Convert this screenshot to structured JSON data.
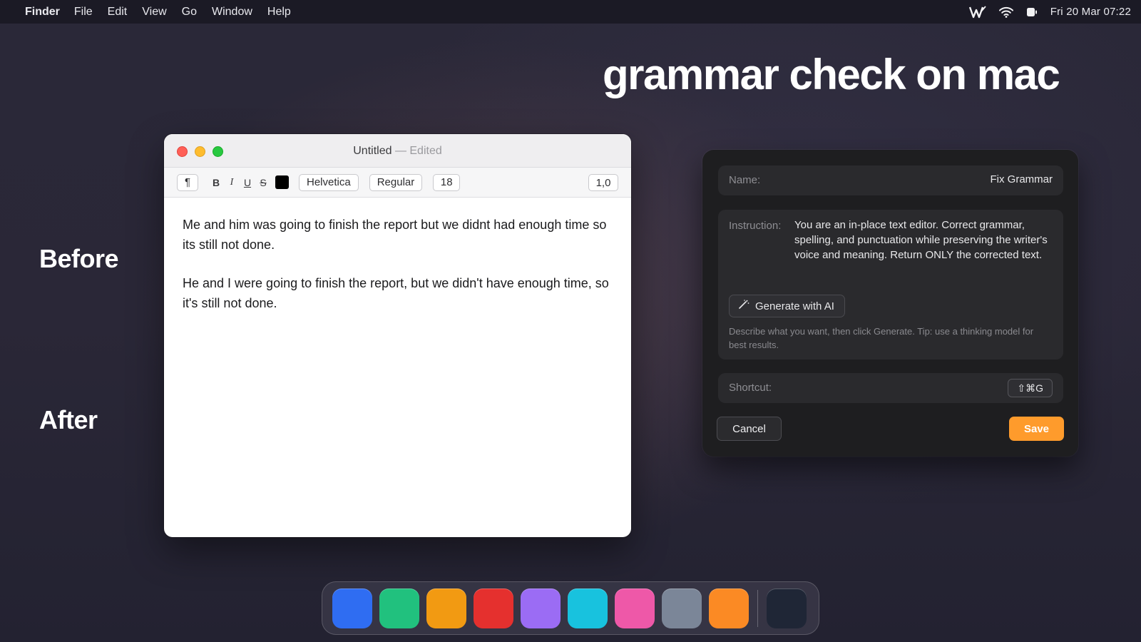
{
  "menubar": {
    "app_name": "Finder",
    "items": [
      "File",
      "Edit",
      "View",
      "Go",
      "Window",
      "Help"
    ],
    "status_icons": [
      "writing-tool-icon",
      "wifi-icon",
      "battery-icon"
    ],
    "clock": "Fri 20 Mar  07:22"
  },
  "headline": "grammar check on mac",
  "labels": {
    "before": "Before",
    "after": "After"
  },
  "editor": {
    "title": "Untitled",
    "title_suffix": "— Edited",
    "toolbar": {
      "paragraph_symbol": "¶",
      "bold": "B",
      "italic": "I",
      "underline": "U",
      "strikethrough": "S",
      "text_color": "#000000",
      "font_family": "Helvetica",
      "font_style": "Regular",
      "font_size": "18",
      "line_spacing": "1,0"
    },
    "paragraphs": [
      "Me and him was going to finish the report but we didnt had enough time so its still not done.",
      "He and I were going to finish the report, but we didn't have enough time, so it's still not done."
    ]
  },
  "panel": {
    "name_label": "Name:",
    "name_value": "Fix Grammar",
    "instruction_label": "Instruction:",
    "instruction_text": "You are an in-place text editor. Correct grammar, spelling, and punctuation while preserving the writer's voice and meaning. Return ONLY the corrected text.",
    "generate_label": "Generate with AI",
    "hint": "Describe what you want, then click Generate. Tip: use a thinking model for best results.",
    "shortcut_label": "Shortcut:",
    "shortcut_value": "⇧⌘G",
    "cancel_label": "Cancel",
    "save_label": "Save",
    "accent_color": "#fe9b2c"
  },
  "dock": {
    "apps": [
      {
        "name": "dock-app-blue",
        "color": "#2f6df2"
      },
      {
        "name": "dock-app-green",
        "color": "#21c17e"
      },
      {
        "name": "dock-app-amber",
        "color": "#f29a12"
      },
      {
        "name": "dock-app-red",
        "color": "#e5302e"
      },
      {
        "name": "dock-app-violet",
        "color": "#9b6cf4"
      },
      {
        "name": "dock-app-cyan",
        "color": "#18c2de"
      },
      {
        "name": "dock-app-pink",
        "color": "#ee58a8"
      },
      {
        "name": "dock-app-slate",
        "color": "#7b8698"
      },
      {
        "name": "dock-app-orange",
        "color": "#fb8a24"
      },
      {
        "name": "dock-app-dark",
        "color": "#1f2636"
      }
    ]
  }
}
